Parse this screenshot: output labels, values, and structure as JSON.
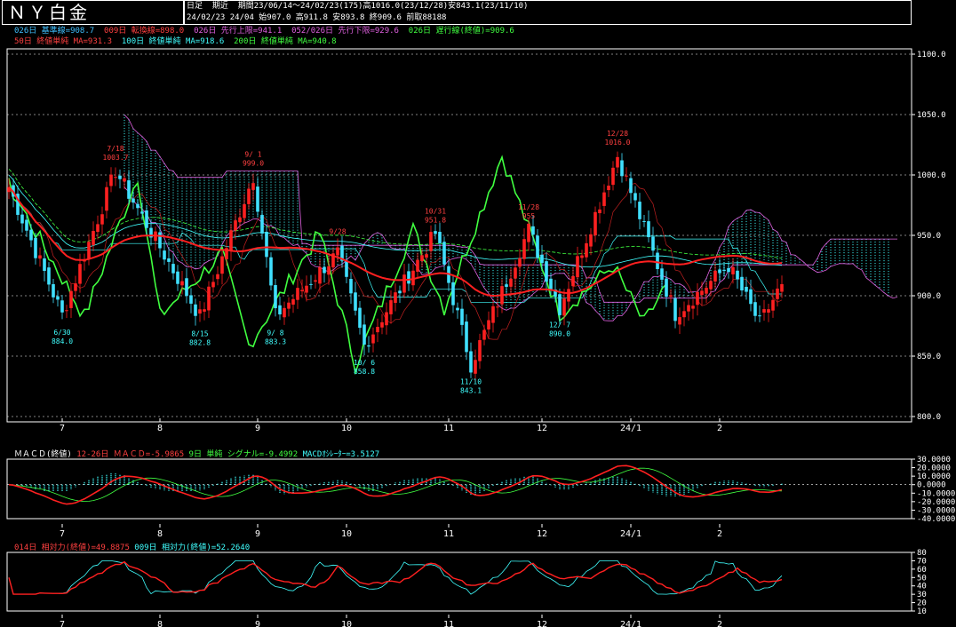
{
  "title": "ＮＹ白金",
  "header": {
    "mode": "日足  期近",
    "period": "期間23/06/14～24/02/23(175)高1016.0(23/12/28)安843.1(23/11/10)",
    "last": "24/02/23 24/04 始907.0 高911.8 安893.8 終909.6 前取88188"
  },
  "legend_row1": [
    {
      "text": "026日 基準線=908.7",
      "color": "#40c0ff"
    },
    {
      "text": "009日 転換線=898.0",
      "color": "#ff4040"
    },
    {
      "text": "026日 先行上限=941.1",
      "color": "#e060e0"
    },
    {
      "text": "052/026日 先行下限=929.6",
      "color": "#e060e0"
    },
    {
      "text": "026日 遅行線(終値)=909.6",
      "color": "#40ff40"
    }
  ],
  "legend_row2": [
    {
      "text": "50日 終値単純 MA=931.3",
      "color": "#ff4040"
    },
    {
      "text": "100日 終値単純 MA=918.6",
      "color": "#40ffff"
    },
    {
      "text": "200日 終値単純 MA=940.8",
      "color": "#40ff40"
    }
  ],
  "price_axis": {
    "min": 800,
    "max": 1100,
    "ticks": [
      "1100.0",
      "1050.0",
      "1000.0",
      "950.0",
      "900.0",
      "850.0",
      "800.0"
    ]
  },
  "x_labels": [
    "7",
    "8",
    "9",
    "10",
    "11",
    "12",
    "24/1",
    "2"
  ],
  "annotations": [
    {
      "date": "6/30",
      "value": "884.0",
      "color": "#40ffff"
    },
    {
      "date": "7/18",
      "value": "1003.7",
      "color": "#ff4040"
    },
    {
      "date": "8/15",
      "value": "882.8",
      "color": "#40ffff"
    },
    {
      "date": "9/ 1",
      "value": "999.0",
      "color": "#ff4040"
    },
    {
      "date": "9/ 8",
      "value": "883.3",
      "color": "#40ffff"
    },
    {
      "date": "9/28",
      "value": "",
      "color": "#ff4040"
    },
    {
      "date": "10/ 6",
      "value": "858.8",
      "color": "#40ffff"
    },
    {
      "date": "10/31",
      "value": "951.8",
      "color": "#ff4040"
    },
    {
      "date": "11/10",
      "value": "843.1",
      "color": "#40ffff"
    },
    {
      "date": "11/28",
      "value": "955",
      "color": "#ff4040"
    },
    {
      "date": "12/ 7",
      "value": "890.0",
      "color": "#40ffff"
    },
    {
      "date": "12/28",
      "value": "1016.0",
      "color": "#ff4040"
    }
  ],
  "macd": {
    "label": "ＭＡＣＤ(終値)",
    "line_text": "12-26日 ＭＡＣＤ=-5.9865",
    "signal_text": "9日 単純 シグナル=-9.4992",
    "osc_text": "MACDｵｼﾚｰﾀｰ=3.5127",
    "ticks": [
      "30.0000",
      "20.0000",
      "10.0000",
      "0.0000",
      "-10.0000",
      "-20.0000",
      "-30.0000",
      "-40.0000"
    ]
  },
  "rsi": {
    "line1_text": "014日 相対力(終値)=49.8875",
    "line2_text": "009日 相対力(終値)=52.2640",
    "ticks": [
      "80",
      "70",
      "60",
      "50",
      "40",
      "30",
      "20",
      "10"
    ]
  },
  "colors": {
    "up": "#ff2020",
    "down": "#40e0ff",
    "ma50": "#ff2020",
    "ma100": "#40ffff",
    "ma200": "#40ff40",
    "chikou": "#40ff40",
    "cloud": "#40ffff",
    "span": "#e060e0"
  },
  "chart_data": [
    {
      "type": "candlestick",
      "title": "ＮＹ白金",
      "xlabel": "",
      "ylabel": "",
      "ylim": [
        800,
        1100
      ],
      "x_range": [
        "23/06/14",
        "24/02/23"
      ],
      "month_labels": [
        "7",
        "8",
        "9",
        "10",
        "11",
        "12",
        "24/1",
        "2"
      ],
      "key_points": [
        {
          "date": "23/06/14",
          "value": 990
        },
        {
          "date": "23/06/30",
          "value": 884.0,
          "label": "low"
        },
        {
          "date": "23/07/18",
          "value": 1003.7,
          "label": "high"
        },
        {
          "date": "23/08/15",
          "value": 882.8,
          "label": "low"
        },
        {
          "date": "23/09/01",
          "value": 999.0,
          "label": "high"
        },
        {
          "date": "23/09/08",
          "value": 883.3,
          "label": "low"
        },
        {
          "date": "23/09/28",
          "value": 935
        },
        {
          "date": "23/10/06",
          "value": 858.8,
          "label": "low"
        },
        {
          "date": "23/10/31",
          "value": 951.8,
          "label": "high"
        },
        {
          "date": "23/11/10",
          "value": 843.1,
          "label": "low"
        },
        {
          "date": "23/11/28",
          "value": 955,
          "label": "high"
        },
        {
          "date": "23/12/07",
          "value": 890.0,
          "label": "low"
        },
        {
          "date": "23/12/28",
          "value": 1016.0,
          "label": "high"
        },
        {
          "date": "24/01/17",
          "value": 885
        },
        {
          "date": "24/02/02",
          "value": 925
        },
        {
          "date": "24/02/13",
          "value": 877
        },
        {
          "date": "24/02/23",
          "value": 909.6,
          "label": "close"
        }
      ],
      "series": [
        {
          "name": "50日 終値単純 MA",
          "last": 931.3
        },
        {
          "name": "100日 終値単純 MA",
          "last": 918.6
        },
        {
          "name": "200日 終値単純 MA",
          "last": 940.8
        },
        {
          "name": "026日 基準線",
          "last": 908.7
        },
        {
          "name": "009日 転換線",
          "last": 898.0
        },
        {
          "name": "026日 先行上限",
          "last": 941.1
        },
        {
          "name": "052/026日 先行下限",
          "last": 929.6
        },
        {
          "name": "026日 遅行線(終値)",
          "last": 909.6
        }
      ]
    },
    {
      "type": "line",
      "title": "ＭＡＣＤ(終値)",
      "ylim": [
        -40,
        30
      ],
      "series": [
        {
          "name": "12-26日 ＭＡＣＤ",
          "last": -5.9865
        },
        {
          "name": "9日 単純 シグナル",
          "last": -9.4992
        },
        {
          "name": "MACDｵｼﾚｰﾀｰ",
          "last": 3.5127
        }
      ]
    },
    {
      "type": "line",
      "title": "相対力",
      "ylim": [
        10,
        80
      ],
      "series": [
        {
          "name": "014日 相対力(終値)",
          "last": 49.8875
        },
        {
          "name": "009日 相対力(終値)",
          "last": 52.264
        }
      ]
    }
  ]
}
